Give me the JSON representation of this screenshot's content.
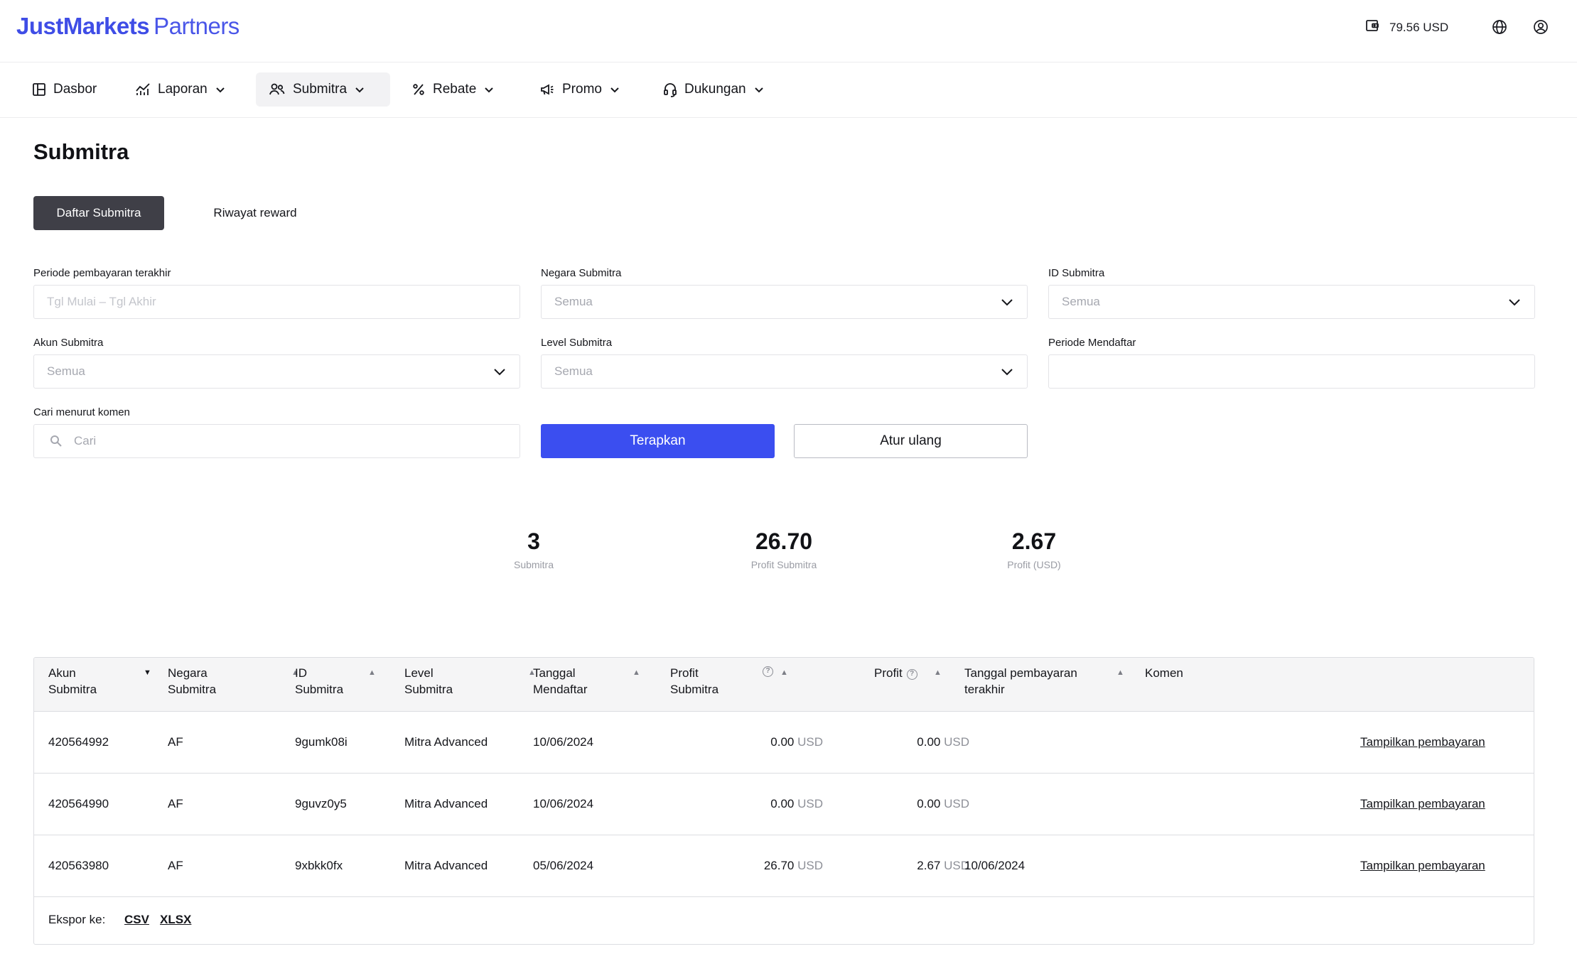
{
  "header": {
    "brand": "JustMarkets",
    "brand_suffix": "Partners",
    "balance": "79.56 USD"
  },
  "nav": {
    "items": [
      {
        "label": "Dasbor",
        "icon": "dashboard-icon"
      },
      {
        "label": "Laporan",
        "icon": "chart-icon"
      },
      {
        "label": "Submitra",
        "icon": "users-icon"
      },
      {
        "label": "Rebate",
        "icon": "percent-icon"
      },
      {
        "label": "Promo",
        "icon": "megaphone-icon"
      },
      {
        "label": "Dukungan",
        "icon": "headset-icon"
      }
    ]
  },
  "page": {
    "title": "Submitra",
    "tabs": [
      "Daftar Submitra",
      "Riwayat reward"
    ]
  },
  "filters": {
    "last_payment_period": {
      "label": "Periode pembayaran terakhir",
      "placeholder": "Tgl Mulai – Tgl Akhir"
    },
    "country": {
      "label": "Negara Submitra",
      "value": "Semua"
    },
    "id": {
      "label": "ID Submitra",
      "value": "Semua"
    },
    "account": {
      "label": "Akun Submitra",
      "value": "Semua"
    },
    "level": {
      "label": "Level Submitra",
      "value": "Semua"
    },
    "register_period": {
      "label": "Periode Mendaftar",
      "value": ""
    },
    "comment_search": {
      "label": "Cari menurut komen",
      "placeholder": "Cari"
    },
    "apply": "Terapkan",
    "reset": "Atur ulang"
  },
  "stats": [
    {
      "value": "3",
      "label": "Submitra"
    },
    {
      "value": "26.70",
      "label": "Profit Submitra"
    },
    {
      "value": "2.67",
      "label": "Profit (USD)"
    }
  ],
  "table": {
    "headers": {
      "account": [
        "Akun",
        "Submitra"
      ],
      "country": [
        "Negara",
        "Submitra"
      ],
      "id": [
        "ID",
        "Submitra"
      ],
      "level": [
        "Level",
        "Submitra"
      ],
      "reg_date": [
        "Tanggal",
        "Mendaftar"
      ],
      "sub_profit": [
        "Profit",
        "Submitra"
      ],
      "profit": "Profit",
      "last_payment": [
        "Tanggal pembayaran",
        "terakhir"
      ],
      "comment": "Komen"
    },
    "rows": [
      {
        "account": "420564992",
        "country": "AF",
        "id": "9gumk08i",
        "level": "Mitra Advanced",
        "reg_date": "10/06/2024",
        "sub_profit": "0.00",
        "profit": "0.00",
        "currency": "USD",
        "last_payment": "",
        "action": "Tampilkan pembayaran"
      },
      {
        "account": "420564990",
        "country": "AF",
        "id": "9guvz0y5",
        "level": "Mitra Advanced",
        "reg_date": "10/06/2024",
        "sub_profit": "0.00",
        "profit": "0.00",
        "currency": "USD",
        "last_payment": "",
        "action": "Tampilkan pembayaran"
      },
      {
        "account": "420563980",
        "country": "AF",
        "id": "9xbkk0fx",
        "level": "Mitra Advanced",
        "reg_date": "05/06/2024",
        "sub_profit": "26.70",
        "profit": "2.67",
        "currency": "USD",
        "last_payment": "10/06/2024",
        "action": "Tampilkan pembayaran"
      }
    ],
    "export_label": "Ekspor ke:",
    "export_formats": [
      "CSV",
      "XLSX"
    ]
  }
}
